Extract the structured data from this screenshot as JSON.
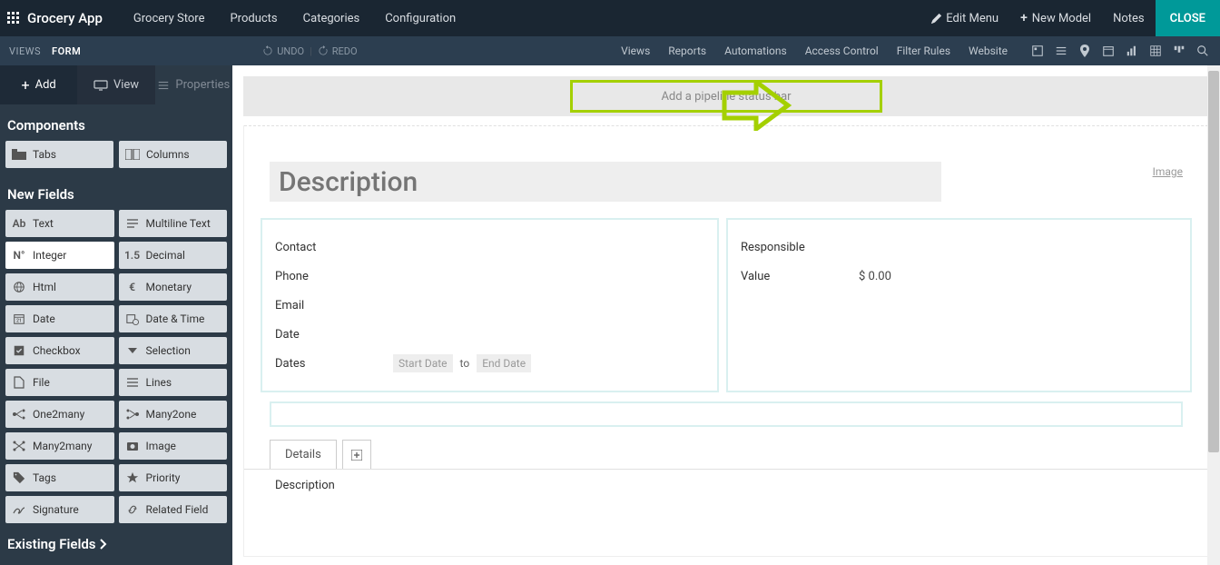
{
  "topbar": {
    "app_name": "Grocery App",
    "menus": [
      "Grocery Store",
      "Products",
      "Categories",
      "Configuration"
    ],
    "edit_menu": "Edit Menu",
    "new_model": "New Model",
    "notes": "Notes",
    "close": "CLOSE"
  },
  "subbar": {
    "views": "VIEWS",
    "form": "FORM",
    "undo": "UNDO",
    "redo": "REDO",
    "links": [
      "Views",
      "Reports",
      "Automations",
      "Access Control",
      "Filter Rules",
      "Website"
    ]
  },
  "sidebar": {
    "tabs": {
      "add": "Add",
      "view": "View",
      "properties": "Properties"
    },
    "components_title": "Components",
    "components": {
      "tabs": "Tabs",
      "columns": "Columns"
    },
    "new_fields_title": "New Fields",
    "fields": {
      "text": "Text",
      "multiline": "Multiline Text",
      "integer": "Integer",
      "decimal": "Decimal",
      "html": "Html",
      "monetary": "Monetary",
      "date": "Date",
      "datetime": "Date & Time",
      "checkbox": "Checkbox",
      "selection": "Selection",
      "file": "File",
      "lines": "Lines",
      "one2many": "One2many",
      "many2one": "Many2one",
      "many2many": "Many2many",
      "image": "Image",
      "tags": "Tags",
      "priority": "Priority",
      "signature": "Signature",
      "related": "Related Field"
    },
    "existing_fields": "Existing Fields"
  },
  "canvas": {
    "pipeline_placeholder": "Add a pipeline status bar",
    "description_placeholder": "Description",
    "image_link": "Image",
    "left_fields": {
      "contact": "Contact",
      "phone": "Phone",
      "email": "Email",
      "date": "Date",
      "dates": "Dates",
      "start_date": "Start Date",
      "to": "to",
      "end_date": "End Date"
    },
    "right_fields": {
      "responsible": "Responsible",
      "value_label": "Value",
      "value": "$ 0.00"
    },
    "details_tab": "Details",
    "description_label": "Description"
  }
}
